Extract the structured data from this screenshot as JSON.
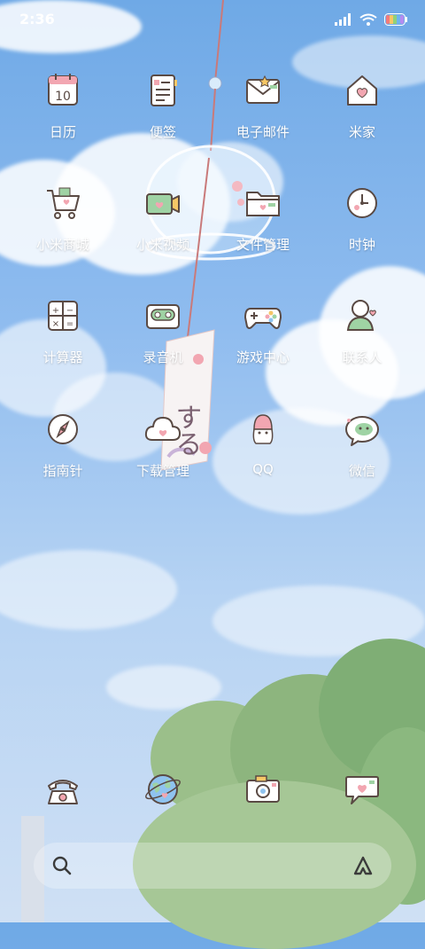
{
  "status_bar": {
    "time": "2:36"
  },
  "apps": [
    {
      "label": "日历",
      "icon": "calendar-icon",
      "day": "10"
    },
    {
      "label": "便签",
      "icon": "notes-icon"
    },
    {
      "label": "电子邮件",
      "icon": "email-icon"
    },
    {
      "label": "米家",
      "icon": "home-icon"
    },
    {
      "label": "小米商城",
      "icon": "shopping-cart-icon"
    },
    {
      "label": "小米视频",
      "icon": "video-icon"
    },
    {
      "label": "文件管理",
      "icon": "folder-icon"
    },
    {
      "label": "时钟",
      "icon": "clock-icon"
    },
    {
      "label": "计算器",
      "icon": "calculator-icon"
    },
    {
      "label": "录音机",
      "icon": "recorder-icon"
    },
    {
      "label": "游戏中心",
      "icon": "gamepad-icon"
    },
    {
      "label": "联系人",
      "icon": "contacts-icon"
    },
    {
      "label": "指南针",
      "icon": "compass-icon"
    },
    {
      "label": "下载管理",
      "icon": "download-cloud-icon"
    },
    {
      "label": "QQ",
      "icon": "qq-icon"
    },
    {
      "label": "微信",
      "icon": "wechat-icon"
    }
  ],
  "dock": [
    {
      "icon": "phone-icon"
    },
    {
      "icon": "browser-globe-icon"
    },
    {
      "icon": "camera-icon"
    },
    {
      "icon": "messages-icon"
    }
  ],
  "chime_text": "する",
  "colors": {
    "accent": "#e58a93",
    "outline": "#5a4a44",
    "text": "#ffffff"
  }
}
